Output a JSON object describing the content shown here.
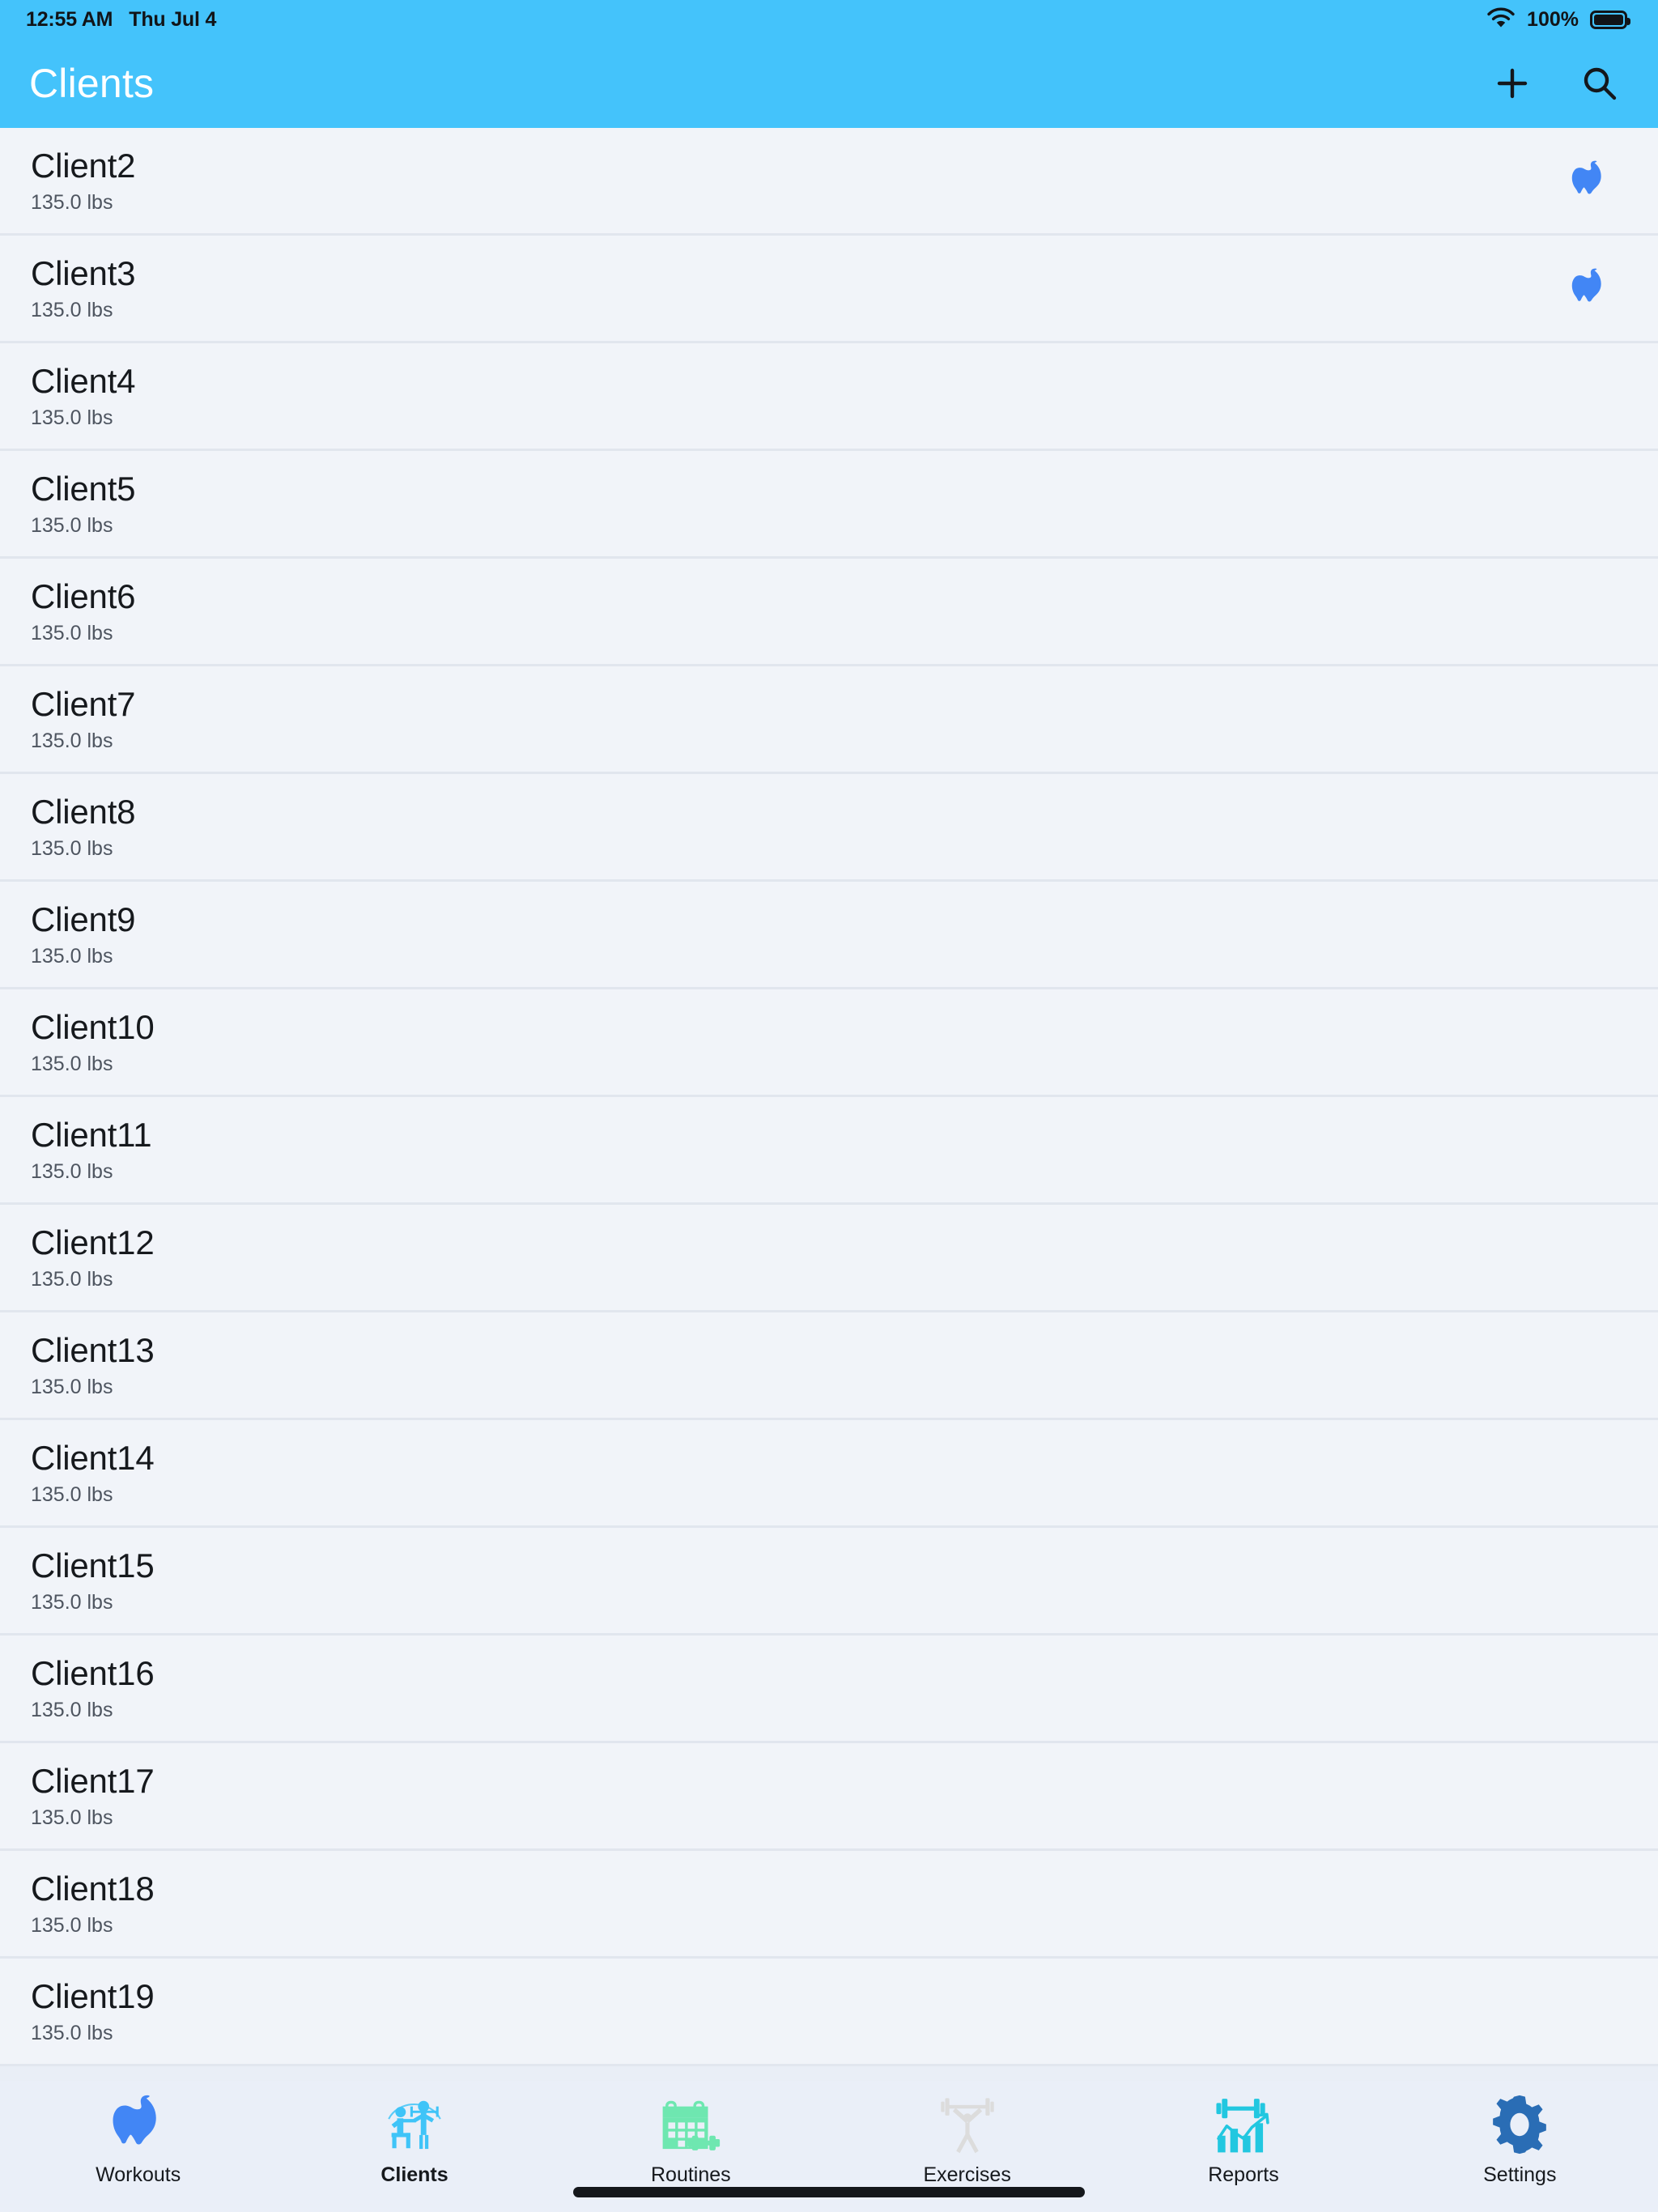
{
  "status_bar": {
    "time": "12:55 AM",
    "date": "Thu Jul 4",
    "battery_percent": "100%",
    "wifi_icon": "wifi-icon",
    "battery_icon": "battery-full-icon"
  },
  "nav_bar": {
    "title": "Clients",
    "background_color": "#44c3fb",
    "title_color": "#ffffff",
    "actions": [
      {
        "name": "add-client-button",
        "icon": "plus-icon",
        "label": "Add"
      },
      {
        "name": "search-button",
        "icon": "search-icon",
        "label": "Search"
      }
    ]
  },
  "list": {
    "row_background": "#f1f4f9",
    "badge_icon": "muscle-icon",
    "badge_color": "#4286f5",
    "rows": [
      {
        "title": "Client2",
        "subtitle": "135.0 lbs",
        "badge": true
      },
      {
        "title": "Client3",
        "subtitle": "135.0 lbs",
        "badge": true
      },
      {
        "title": "Client4",
        "subtitle": "135.0 lbs",
        "badge": false
      },
      {
        "title": "Client5",
        "subtitle": "135.0 lbs",
        "badge": false
      },
      {
        "title": "Client6",
        "subtitle": "135.0 lbs",
        "badge": false
      },
      {
        "title": "Client7",
        "subtitle": "135.0 lbs",
        "badge": false
      },
      {
        "title": "Client8",
        "subtitle": "135.0 lbs",
        "badge": false
      },
      {
        "title": "Client9",
        "subtitle": "135.0 lbs",
        "badge": false
      },
      {
        "title": "Client10",
        "subtitle": "135.0 lbs",
        "badge": false
      },
      {
        "title": "Client11",
        "subtitle": "135.0 lbs",
        "badge": false
      },
      {
        "title": "Client12",
        "subtitle": "135.0 lbs",
        "badge": false
      },
      {
        "title": "Client13",
        "subtitle": "135.0 lbs",
        "badge": false
      },
      {
        "title": "Client14",
        "subtitle": "135.0 lbs",
        "badge": false
      },
      {
        "title": "Client15",
        "subtitle": "135.0 lbs",
        "badge": false
      },
      {
        "title": "Client16",
        "subtitle": "135.0 lbs",
        "badge": false
      },
      {
        "title": "Client17",
        "subtitle": "135.0 lbs",
        "badge": false
      },
      {
        "title": "Client18",
        "subtitle": "135.0 lbs",
        "badge": false
      },
      {
        "title": "Client19",
        "subtitle": "135.0 lbs",
        "badge": false
      }
    ]
  },
  "tab_bar": {
    "background_color": "#eaeff8",
    "active_tab": "Clients",
    "tabs": [
      {
        "label": "Workouts",
        "icon": "muscle-icon",
        "color": "#4286f5",
        "active": false
      },
      {
        "label": "Clients",
        "icon": "trainer-client-icon",
        "color": "#3fc4f8",
        "active": true
      },
      {
        "label": "Routines",
        "icon": "calendar-dumbbell-icon",
        "color": "#6ee7b0",
        "active": false
      },
      {
        "label": "Exercises",
        "icon": "barbell-lifter-icon",
        "color": "#dcdcdc",
        "active": false
      },
      {
        "label": "Reports",
        "icon": "chart-barbell-icon",
        "color": "#22c7e0",
        "active": false
      },
      {
        "label": "Settings",
        "icon": "gear-icon",
        "color": "#2a6db5",
        "active": false
      }
    ]
  },
  "home_indicator": {
    "name": "home-indicator"
  }
}
